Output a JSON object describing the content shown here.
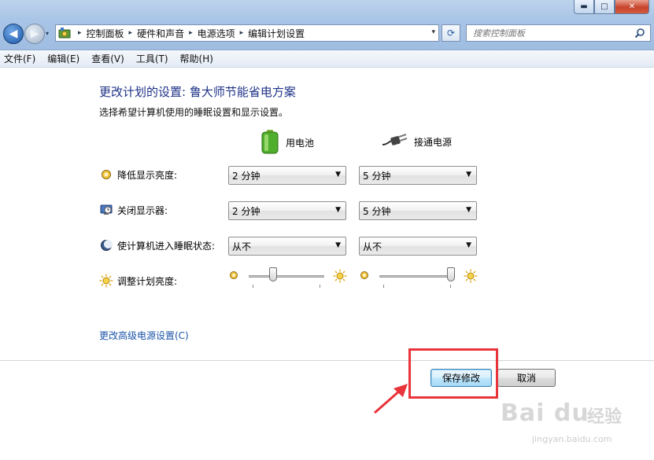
{
  "window": {
    "controls": {
      "minimize": "▬",
      "maximize": "□",
      "close": "✕"
    }
  },
  "nav": {
    "back_glyph": "◀",
    "forward_glyph": "▶",
    "history_glyph": "▾",
    "breadcrumbs": [
      "控制面板",
      "硬件和声音",
      "电源选项",
      "编辑计划设置"
    ],
    "separator": "▸",
    "address_dropdown_glyph": "▾",
    "refresh_glyph": "⟳",
    "search_placeholder": "搜索控制面板"
  },
  "menu": [
    "文件(F)",
    "编辑(E)",
    "查看(V)",
    "工具(T)",
    "帮助(H)"
  ],
  "main": {
    "title": "更改计划的设置: 鲁大师节能省电方案",
    "subtitle": "选择希望计算机使用的睡眠设置和显示设置。",
    "columns": {
      "battery": "用电池",
      "plugged": "接通电源"
    },
    "rows": [
      {
        "label": "降低显示亮度:",
        "icon": "dim-display-icon",
        "battery": "2 分钟",
        "plugged": "5 分钟"
      },
      {
        "label": "关闭显示器:",
        "icon": "monitor-off-icon",
        "battery": "2 分钟",
        "plugged": "5 分钟"
      },
      {
        "label": "使计算机进入睡眠状态:",
        "icon": "sleep-moon-icon",
        "battery": "从不",
        "plugged": "从不"
      }
    ],
    "brightness": {
      "label": "调整计划亮度:",
      "battery_level": 0.3,
      "plugged_level": 1.0
    },
    "dropdown_glyph": "▼",
    "advanced_link": "更改高级电源设置(C)"
  },
  "buttons": {
    "save": "保存修改",
    "cancel": "取消"
  },
  "annotation": {
    "box_color": "#e8343a"
  },
  "watermark": {
    "brand": "Bai du",
    "jingyan": "经验",
    "url": "jingyan.baidu.com"
  },
  "colors": {
    "title": "#1e3287",
    "link": "#1b53a8"
  }
}
